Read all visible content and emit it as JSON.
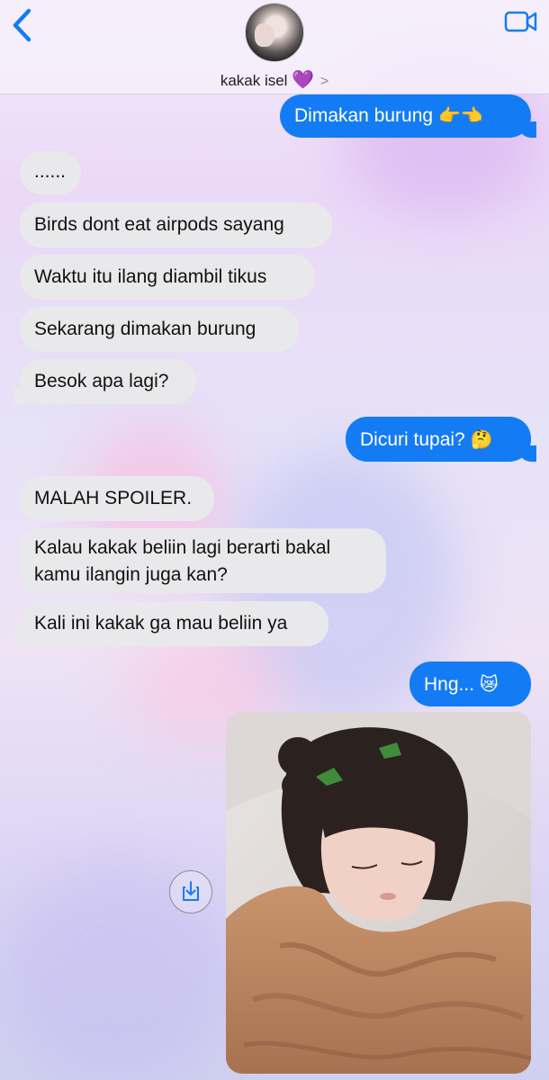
{
  "header": {
    "contact_name": "kakak isel",
    "heart_emoji": "💜",
    "chevron": ">",
    "back_icon": "chevron-left-icon",
    "video_icon": "video-camera-icon"
  },
  "colors": {
    "sent_bubble": "#137cf5",
    "received_bubble": "#e9e9eb",
    "accent": "#137cf5"
  },
  "messages": [
    {
      "from": "me",
      "text": "Dimakan burung",
      "emoji": "👉👈"
    },
    {
      "from": "them",
      "text": "......"
    },
    {
      "from": "them",
      "text": "Birds dont eat airpods sayang"
    },
    {
      "from": "them",
      "text": "Waktu itu ilang diambil tikus"
    },
    {
      "from": "them",
      "text": "Sekarang dimakan burung"
    },
    {
      "from": "them",
      "text": "Besok apa lagi?"
    },
    {
      "from": "me",
      "text": "Dicuri tupai?",
      "emoji": "🤔"
    },
    {
      "from": "them",
      "text": "MALAH SPOILER."
    },
    {
      "from": "them",
      "line1": "Kalau kakak beliin lagi berarti bakal",
      "line2": "kamu ilangin juga kan?"
    },
    {
      "from": "them",
      "text": "Kali ini kakak ga mau beliin ya"
    },
    {
      "from": "me",
      "text": "Hng...",
      "emoji": "😿"
    }
  ],
  "attachment": {
    "type": "photo",
    "save_icon": "save-download-icon"
  }
}
